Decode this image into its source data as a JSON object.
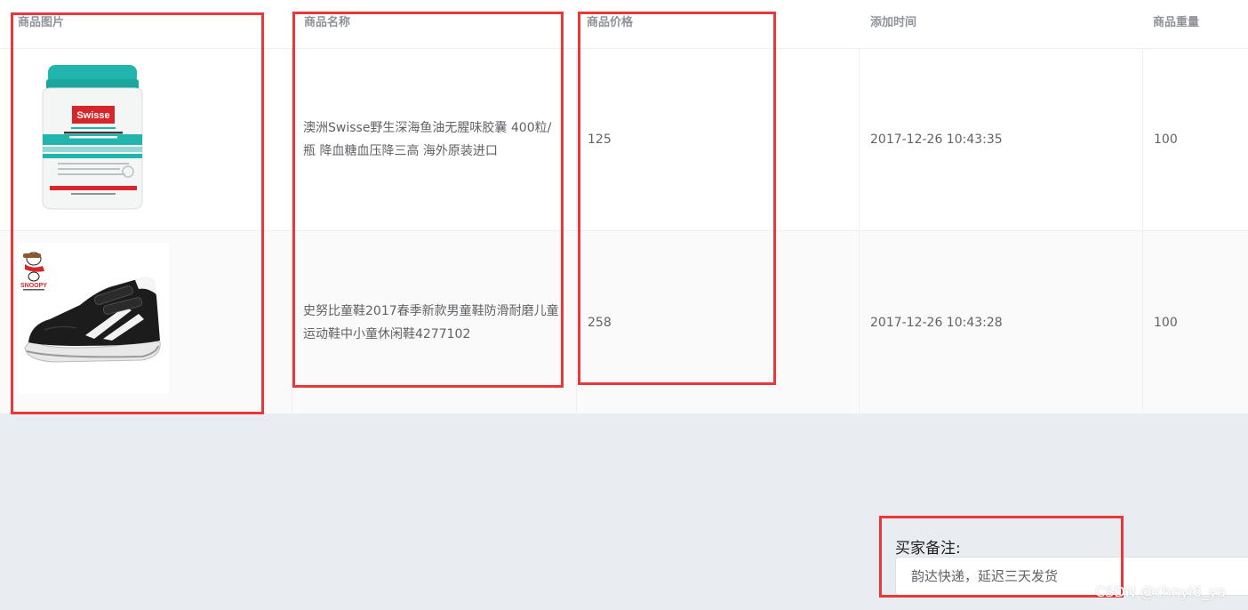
{
  "table": {
    "headers": [
      "商品图片",
      "商品名称",
      "商品价格",
      "添加时间",
      "商品重量"
    ],
    "rows": [
      {
        "image": "fish-oil-bottle-image",
        "brand": "Swisse",
        "name": "澳洲Swisse野生深海鱼油无腥味胶囊 400粒/瓶 降血糖血压降三高 海外原装进口",
        "price": "125",
        "time": "2017-12-26 10:43:35",
        "weight": "100"
      },
      {
        "image": "snoopy-kids-shoe-image",
        "brand": "SNOOPY",
        "name": "史努比童鞋2017春季新款男童鞋防滑耐磨儿童运动鞋中小童休闲鞋4277102",
        "price": "258",
        "time": "2017-12-26 10:43:28",
        "weight": "100"
      }
    ]
  },
  "remark": {
    "label": "买家备注:",
    "value": "韵达快递，延迟三天发货"
  },
  "watermark": "CSDN @chnyi6_ya",
  "colors": {
    "highlight_box": "#e8383a",
    "page_background": "#e9ecf1",
    "header_text": "#909399",
    "cell_text": "#606266",
    "bottle_teal": "#22b5ad",
    "swisse_red": "#d7262b"
  }
}
